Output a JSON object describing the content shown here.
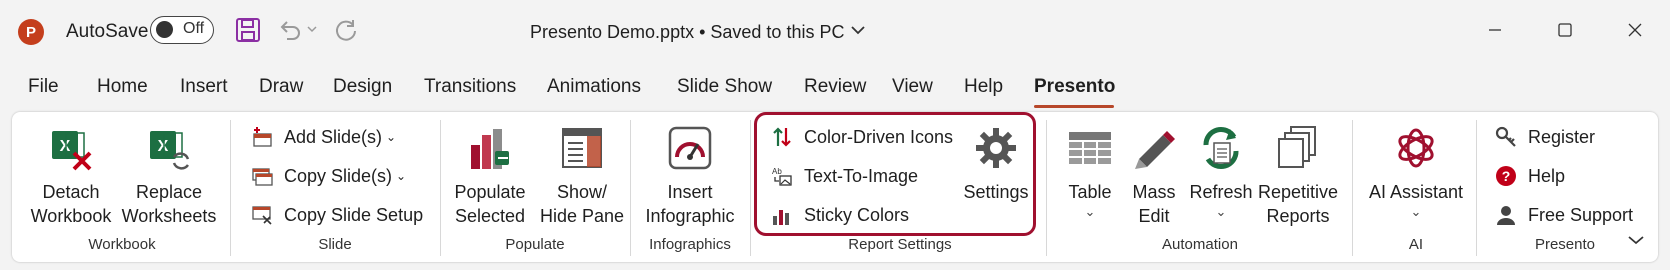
{
  "titlebar": {
    "app_logo": "P",
    "autosave_label": "AutoSave",
    "autosave_state": "Off",
    "document_title": "Presento Demo.pptx • Saved to this PC"
  },
  "tabs": [
    "File",
    "Home",
    "Insert",
    "Draw",
    "Design",
    "Transitions",
    "Animations",
    "Slide Show",
    "Review",
    "View",
    "Help",
    "Presento"
  ],
  "active_tab": "Presento",
  "ribbon": {
    "workbook": {
      "label": "Workbook",
      "detach": [
        "Detach",
        "Workbook"
      ],
      "replace": [
        "Replace",
        "Worksheets"
      ]
    },
    "slide": {
      "label": "Slide",
      "add": "Add Slide(s)",
      "copy": "Copy Slide(s)",
      "setup": "Copy Slide Setup"
    },
    "populate": {
      "label": "Populate",
      "populate_selected": [
        "Populate",
        "Selected"
      ],
      "show_hide": [
        "Show/",
        "Hide Pane"
      ]
    },
    "infographics": {
      "label": "Infographics",
      "insert": [
        "Insert",
        "Infographic"
      ]
    },
    "report_settings": {
      "label": "Report Settings",
      "color_icons": "Color-Driven Icons",
      "text_to_image": "Text-To-Image",
      "sticky_colors": "Sticky Colors",
      "settings": "Settings"
    },
    "automation": {
      "label": "Automation",
      "table": "Table",
      "mass_edit": [
        "Mass",
        "Edit"
      ],
      "refresh": "Refresh",
      "repetitive": [
        "Repetitive",
        "Reports"
      ]
    },
    "ai": {
      "label": "AI",
      "assistant": "AI Assistant"
    },
    "presento": {
      "label": "Presento",
      "register": "Register",
      "help": "Help",
      "support": "Free Support"
    }
  },
  "colors": {
    "brand_red": "#a0102f",
    "excel_green": "#1d6f42",
    "powerpoint_orange": "#c43e1c"
  }
}
